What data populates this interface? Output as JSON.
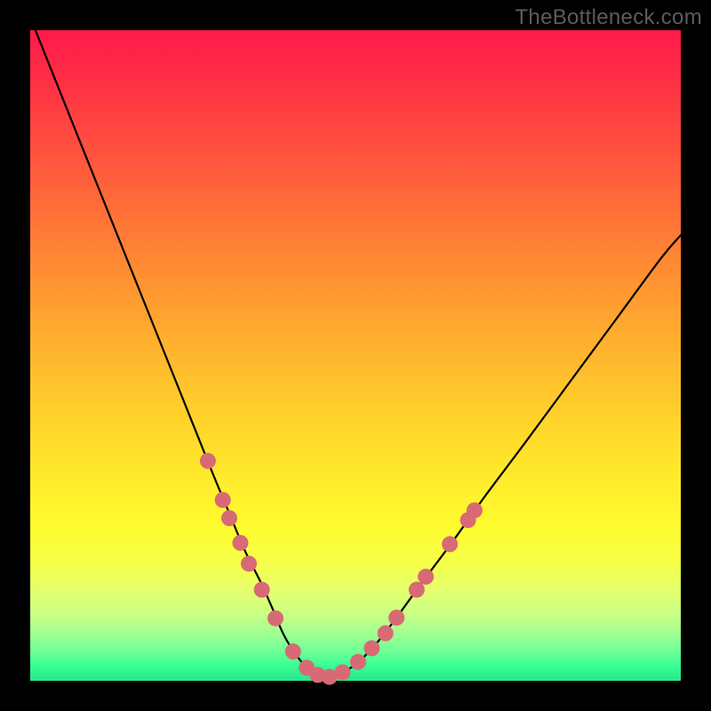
{
  "attribution": "TheBottleneck.com",
  "chart_data": {
    "type": "line",
    "title": "",
    "xlabel": "",
    "ylabel": "",
    "xlim": [
      0,
      100
    ],
    "ylim": [
      0,
      100
    ],
    "background": "rainbow-vertical-gradient",
    "series": [
      {
        "name": "bottleneck-curve",
        "x": [
          0,
          4,
          8,
          12,
          16,
          20,
          24,
          28,
          30.5,
          33,
          35.5,
          37.5,
          39,
          41,
          43,
          45,
          47,
          50,
          53,
          56,
          60,
          65,
          70,
          76,
          83,
          90,
          97,
          100
        ],
        "y": [
          102,
          92,
          82,
          72,
          62,
          52,
          42,
          32,
          26,
          20,
          15,
          10.5,
          7,
          3.8,
          1.6,
          0.6,
          0.9,
          2.5,
          5.5,
          9.3,
          14.8,
          21.5,
          28.5,
          36.5,
          46,
          55.5,
          65,
          68.5
        ]
      }
    ],
    "markers": {
      "color": "#d86a75",
      "radius_px": 9,
      "points": [
        {
          "x": 27.3,
          "y": 33.8
        },
        {
          "x": 29.6,
          "y": 27.8
        },
        {
          "x": 30.6,
          "y": 25.0
        },
        {
          "x": 32.3,
          "y": 21.2
        },
        {
          "x": 33.6,
          "y": 18.0
        },
        {
          "x": 35.6,
          "y": 14.0
        },
        {
          "x": 37.7,
          "y": 9.6
        },
        {
          "x": 40.4,
          "y": 4.5
        },
        {
          "x": 42.5,
          "y": 2.0
        },
        {
          "x": 44.2,
          "y": 0.9
        },
        {
          "x": 46.0,
          "y": 0.6
        },
        {
          "x": 48.0,
          "y": 1.3
        },
        {
          "x": 50.4,
          "y": 2.9
        },
        {
          "x": 52.5,
          "y": 5.0
        },
        {
          "x": 54.6,
          "y": 7.3
        },
        {
          "x": 56.3,
          "y": 9.7
        },
        {
          "x": 59.4,
          "y": 14.0
        },
        {
          "x": 60.8,
          "y": 16.0
        },
        {
          "x": 64.5,
          "y": 21.0
        },
        {
          "x": 67.3,
          "y": 24.7
        },
        {
          "x": 68.3,
          "y": 26.2
        }
      ]
    },
    "notes": "Axis values are unitless 0–100 scales; marker xy are in the same data space as the curve."
  }
}
